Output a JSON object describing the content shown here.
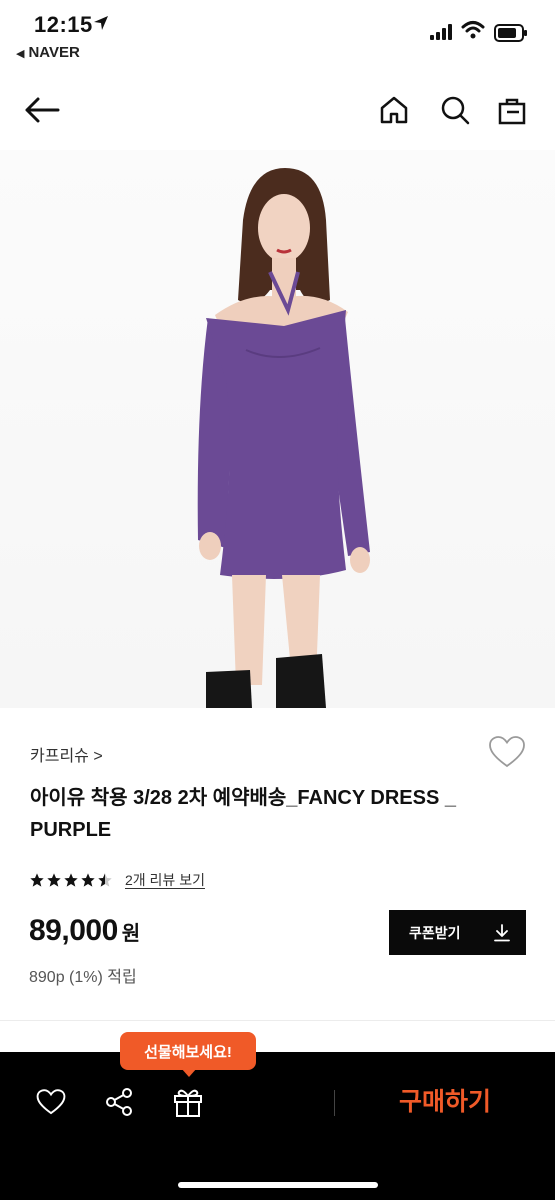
{
  "status_bar": {
    "time": "12:15",
    "back_app": "NAVER"
  },
  "nav": {
    "icons": [
      "back-arrow-icon",
      "home-icon",
      "search-icon",
      "shopping-bag-icon"
    ]
  },
  "product": {
    "brand": "카프리슈 >",
    "title": "아이유 착용 3/28 2차 예약배송_FANCY DRESS _ PURPLE",
    "rating": 4.5,
    "review_link": "2개 리뷰 보기",
    "price": "89,000",
    "price_unit": "원",
    "points": "890p (1%) 적립",
    "coupon_label": "쿠폰받기"
  },
  "bottom_bar": {
    "tooltip": "선물해보세요!",
    "buy_label": "구매하기"
  },
  "colors": {
    "accent": "#f05a28",
    "dress": "#6b4a95",
    "bar": "#000000"
  }
}
